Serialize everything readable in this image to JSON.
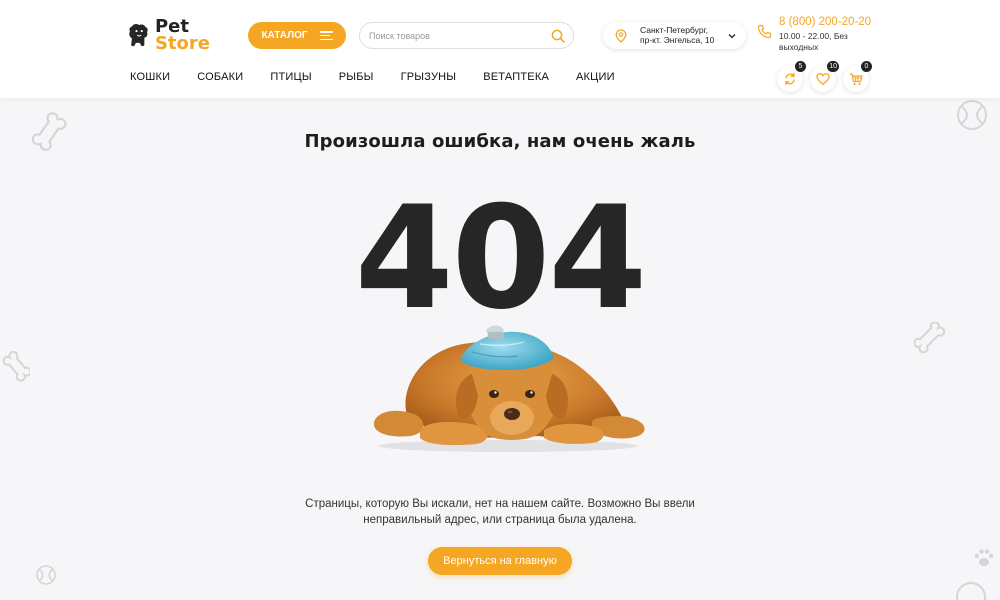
{
  "header": {
    "logo": {
      "line1": "Pet",
      "line2": "Store"
    },
    "catalog_label": "КАТАЛОГ",
    "search": {
      "placeholder": "Поиск товаров",
      "value": ""
    },
    "location": {
      "line1": "Санкт-Петербург,",
      "line2": "пр-кт. Энгельса, 10"
    },
    "phone": "8 (800) 200-20-20",
    "hours": "10.00 - 22.00, Без выходных",
    "nav": [
      "КОШКИ",
      "СОБАКИ",
      "ПТИЦЫ",
      "РЫБЫ",
      "ГРЫЗУНЫ",
      "ВЕТАПТЕКА",
      "АКЦИИ"
    ],
    "counters": {
      "compare": "5",
      "favorites": "10",
      "cart": "0"
    }
  },
  "error": {
    "title": "Произошла ошибка, нам очень жаль",
    "code": "404",
    "text_line1": "Страницы, которую Вы искали, нет на нашем сайте. Возможно Вы ввели",
    "text_line2": "неправильный адрес, или страница была удалена.",
    "button_label": "Вернуться на главную"
  },
  "colors": {
    "accent": "#f5a623",
    "dark": "#262626",
    "background": "#f6f6f8"
  },
  "icons": [
    "logo-dog-icon",
    "burger-icon",
    "search-icon",
    "location-pin-icon",
    "chevron-down-icon",
    "phone-icon",
    "compare-icon",
    "heart-icon",
    "cart-icon",
    "bone-icon",
    "ball-icon",
    "paw-icon"
  ]
}
